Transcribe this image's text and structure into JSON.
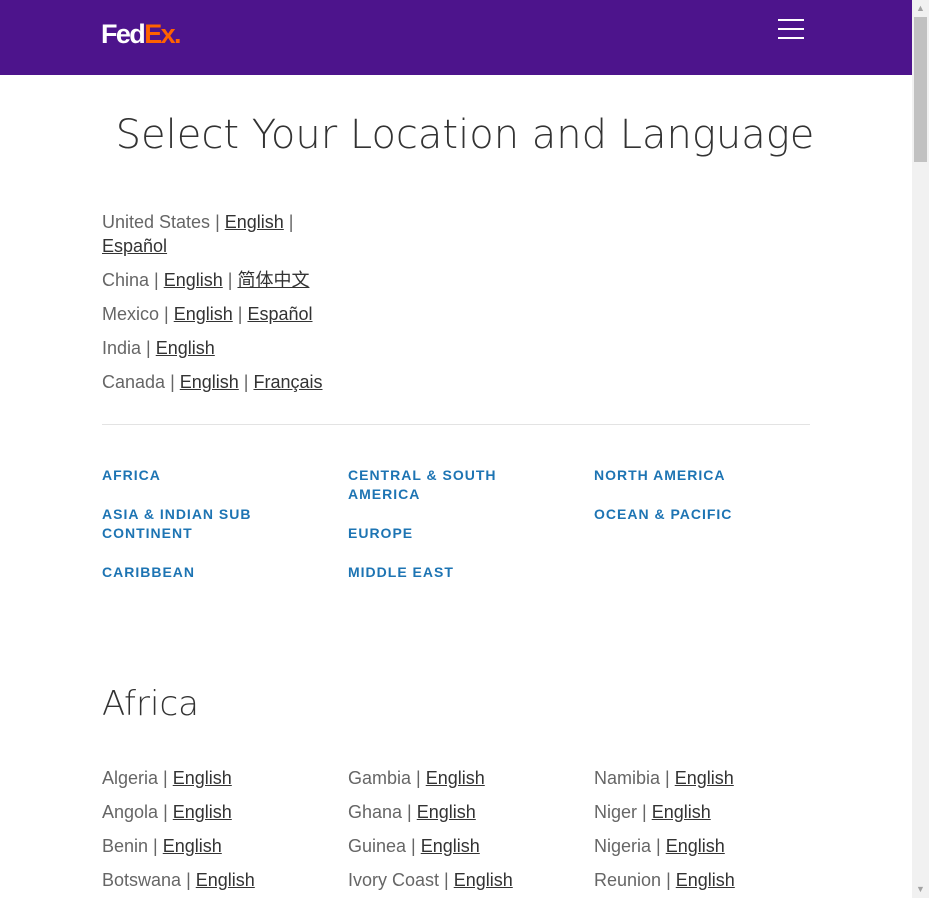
{
  "header": {
    "logo_fed": "Fed",
    "logo_ex": "Ex",
    "logo_dot": ".",
    "menu_icon": "hamburger-menu-icon"
  },
  "page_title": "Select Your Location and Language",
  "featured": [
    {
      "country": "United States",
      "sep1": " | ",
      "lang1": "English",
      "sep2": " | ",
      "lang2": "Español"
    },
    {
      "country": "China",
      "sep1": " | ",
      "lang1": "English",
      "sep2": " | ",
      "lang2": "简体中文"
    },
    {
      "country": "Mexico",
      "sep1": " | ",
      "lang1": "English",
      "sep2": " | ",
      "lang2": "Español"
    },
    {
      "country": "India",
      "sep1": " | ",
      "lang1": "English"
    },
    {
      "country": "Canada",
      "sep1": " | ",
      "lang1": "English",
      "sep2": " | ",
      "lang2": "Français"
    }
  ],
  "regions": {
    "col1": [
      "AFRICA",
      "ASIA & INDIAN SUB CONTINENT",
      "CARIBBEAN"
    ],
    "col2": [
      "CENTRAL & SOUTH AMERICA",
      "EUROPE",
      "MIDDLE EAST"
    ],
    "col3": [
      "NORTH AMERICA",
      "OCEAN & PACIFIC"
    ]
  },
  "africa": {
    "title": "Africa",
    "col1": [
      {
        "country": "Algeria",
        "lang": "English"
      },
      {
        "country": "Angola",
        "lang": "English"
      },
      {
        "country": "Benin",
        "lang": "English"
      },
      {
        "country": "Botswana",
        "lang": "English"
      }
    ],
    "col2": [
      {
        "country": "Gambia",
        "lang": "English"
      },
      {
        "country": "Ghana",
        "lang": "English"
      },
      {
        "country": "Guinea",
        "lang": "English"
      },
      {
        "country": "Ivory Coast",
        "lang": "English"
      }
    ],
    "col3": [
      {
        "country": "Namibia",
        "lang": "English"
      },
      {
        "country": "Niger",
        "lang": "English"
      },
      {
        "country": "Nigeria",
        "lang": "English"
      },
      {
        "country": "Reunion",
        "lang": "English"
      }
    ],
    "sep": " | "
  },
  "colors": {
    "header_bg": "#4d148c",
    "logo_ex": "#ff6200",
    "region_link": "#1d74b3"
  }
}
